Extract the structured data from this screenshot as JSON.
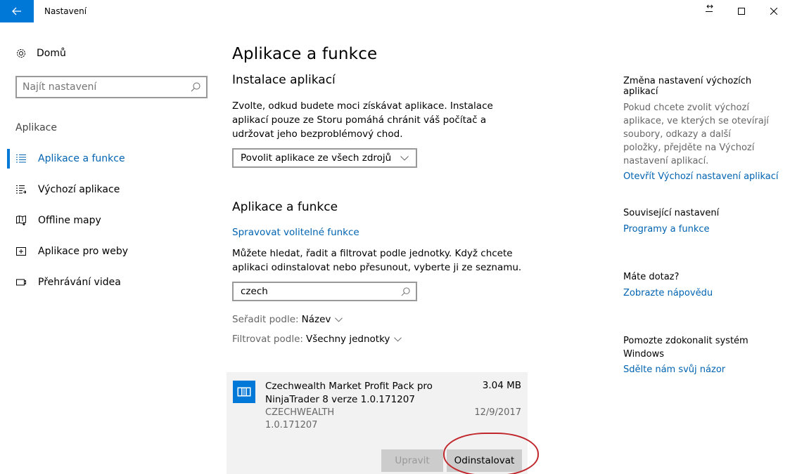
{
  "window": {
    "title": "Nastavení",
    "resize_glyph": "↔"
  },
  "nav": {
    "home_label": "Domů",
    "search_placeholder": "Najít nastavení",
    "section_label": "Aplikace",
    "items": [
      {
        "label": "Aplikace a funkce",
        "icon": "apps-features-icon",
        "active": true
      },
      {
        "label": "Výchozí aplikace",
        "icon": "default-apps-icon",
        "active": false
      },
      {
        "label": "Offline mapy",
        "icon": "offline-maps-icon",
        "active": false
      },
      {
        "label": "Aplikace pro weby",
        "icon": "apps-for-websites-icon",
        "active": false
      },
      {
        "label": "Přehrávání videa",
        "icon": "video-playback-icon",
        "active": false
      }
    ]
  },
  "main": {
    "title": "Aplikace a funkce",
    "install_heading": "Instalace aplikací",
    "install_text": "Zvolte, odkud budete moci získávat aplikace. Instalace aplikací pouze ze Storu pomáhá chránit váš počítač a udržovat jeho bezproblémový chod.",
    "install_dropdown": "Povolit aplikace ze všech zdrojů",
    "apps_heading": "Aplikace a funkce",
    "manage_link": "Spravovat volitelné funkce",
    "apps_text": "Můžete hledat, řadit a filtrovat podle jednotky. Když chcete aplikaci odinstalovat nebo přesunout, vyberte ji ze seznamu.",
    "search_value": "czech",
    "sort_label": "Seřadit podle:",
    "sort_value": "Název",
    "filter_label": "Filtrovat podle:",
    "filter_value": "Všechny jednotky"
  },
  "app": {
    "name": "Czechwealth Market Profit Pack pro NinjaTrader 8 verze 1.0.171207",
    "size": "3.04 MB",
    "publisher": "CZECHWEALTH",
    "version": "1.0.171207",
    "date": "12/9/2017",
    "modify_label": "Upravit",
    "uninstall_label": "Odinstalovat"
  },
  "side": {
    "defaults_title": "Změna nastavení výchozích aplikací",
    "defaults_text": "Pokud chcete zvolit výchozí aplikace, ve kterých se otevírají soubory, odkazy a další položky, přejděte na Výchozí nastavení aplikací.",
    "defaults_link": "Otevřít Výchozí nastavení aplikací",
    "related_title": "Související nastavení",
    "related_link": "Programy a funkce",
    "question_title": "Máte dotaz?",
    "question_link": "Zobrazte nápovědu",
    "improve_title": "Pomozte zdokonalit systém Windows",
    "improve_link": "Sdělte nám svůj názor"
  },
  "colors": {
    "accent": "#0078d7",
    "link": "#0063b1",
    "highlight_circle": "#c0282d"
  }
}
